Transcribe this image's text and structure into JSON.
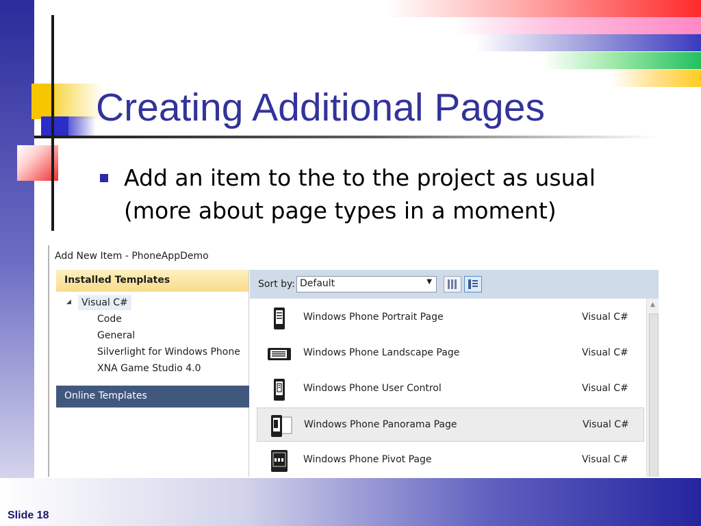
{
  "slide": {
    "title": "Creating Additional Pages",
    "bullet": "Add an item to the to the project as usual (more about page types in a moment)",
    "slide_number": "Slide 18"
  },
  "dialog": {
    "title": "Add New Item - PhoneAppDemo",
    "left_pane": {
      "installed_header": "Installed Templates",
      "tree_root": "Visual C#",
      "tree_children": [
        "Code",
        "General",
        "Silverlight for Windows Phone",
        "XNA Game Studio 4.0"
      ],
      "online_templates": "Online Templates"
    },
    "sortbar": {
      "label": "Sort by:",
      "selected": "Default"
    },
    "items": [
      {
        "name": "Windows Phone Portrait Page",
        "type": "Visual C#",
        "icon": "phone-portrait-icon"
      },
      {
        "name": "Windows Phone Landscape Page",
        "type": "Visual C#",
        "icon": "phone-landscape-icon"
      },
      {
        "name": "Windows Phone User Control",
        "type": "Visual C#",
        "icon": "phone-user-control-icon"
      },
      {
        "name": "Windows Phone Panorama Page",
        "type": "Visual C#",
        "icon": "phone-panorama-icon"
      },
      {
        "name": "Windows Phone Pivot Page",
        "type": "Visual C#",
        "icon": "phone-pivot-icon"
      }
    ],
    "selected_item": "Windows Phone Panorama Page"
  },
  "colors": {
    "title_text": "#33339a",
    "online_templates_bg": "#41587e",
    "installed_header_bg": "#f9dc8a",
    "sortbar_bg": "#cfdbe9"
  }
}
